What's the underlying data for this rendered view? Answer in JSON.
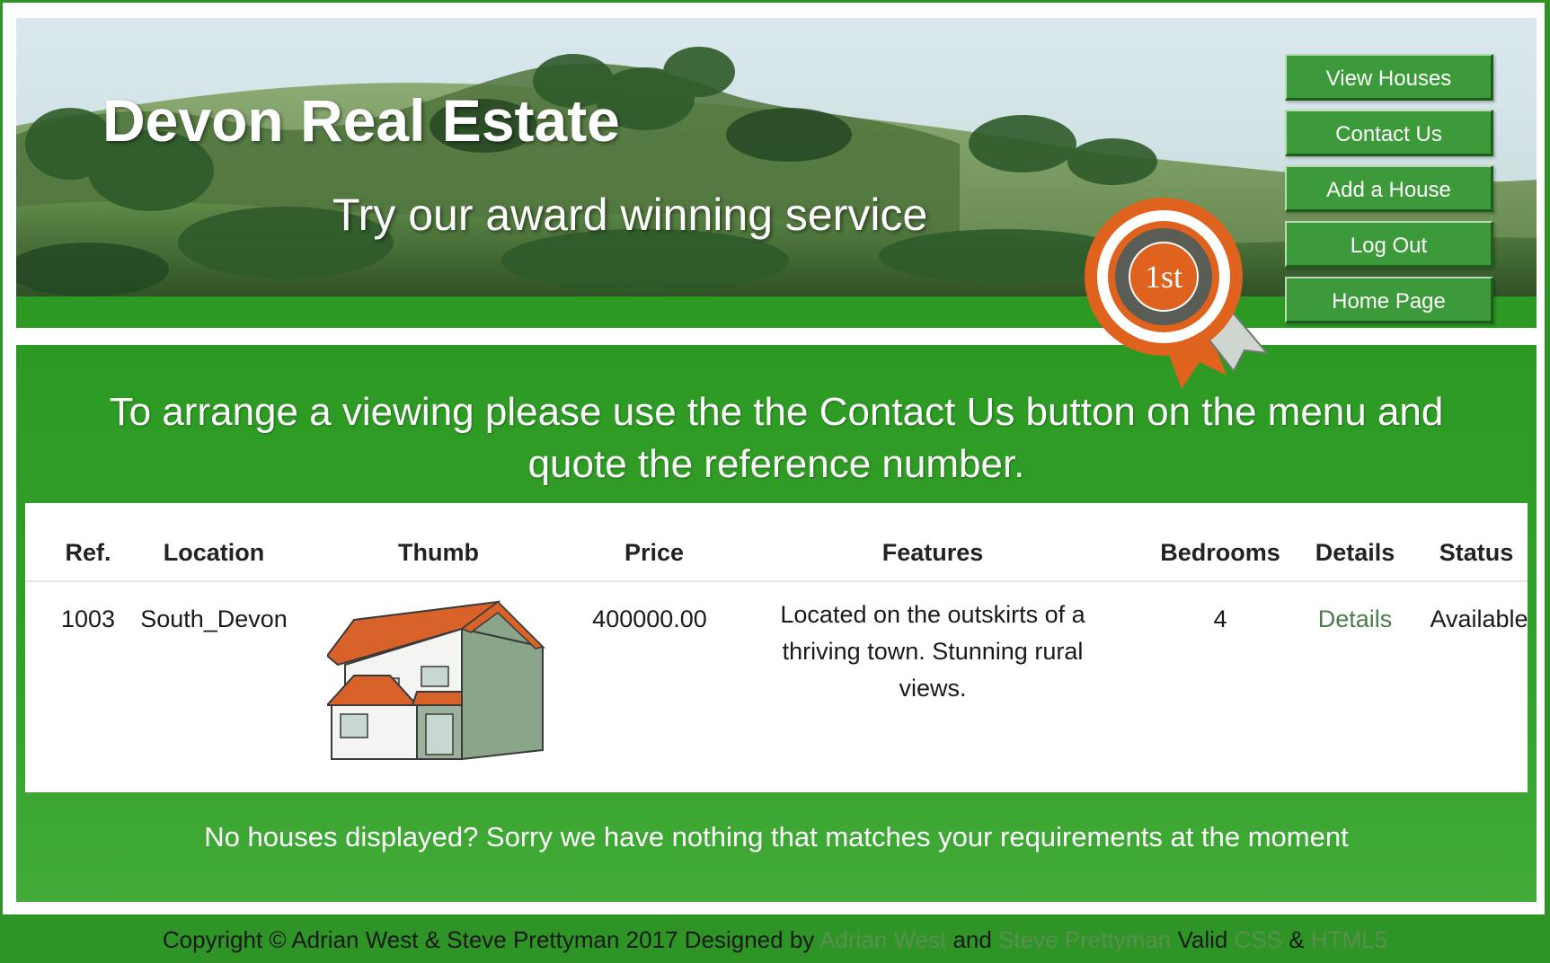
{
  "header": {
    "title": "Devon Real Estate",
    "tagline": "Try our award winning service",
    "badge_text": "1st"
  },
  "nav": {
    "items": [
      {
        "label": "View Houses"
      },
      {
        "label": "Contact Us"
      },
      {
        "label": "Add a House"
      },
      {
        "label": "Log Out"
      },
      {
        "label": "Home Page"
      }
    ]
  },
  "main": {
    "intro_line1": "To arrange a viewing please use the the Contact Us button on the menu and",
    "intro_line2": "quote the reference number.",
    "no_houses": "No houses displayed? Sorry we have nothing that matches your requirements at the moment"
  },
  "table": {
    "headers": [
      "Ref.",
      "Location",
      "Thumb",
      "Price",
      "Features",
      "Bedrooms",
      "Details",
      "Status"
    ],
    "rows": [
      {
        "ref": "1003",
        "location": "South_Devon",
        "price": "400000.00",
        "features_line1": "Located on the outskirts of a",
        "features_line2": "thriving town. Stunning rural",
        "features_line3": "views.",
        "bedrooms": "4",
        "details": "Details",
        "status": "Available"
      }
    ]
  },
  "footer": {
    "text_prefix": "Copyright © Adrian West & Steve Prettyman 2017 Designed by ",
    "author1": "Adrian West",
    "and": " and ",
    "author2": "Steve Prettyman",
    "valid": " Valid ",
    "css": "CSS",
    "amp": " & ",
    "html5": "HTML5"
  },
  "colors": {
    "brand_green": "#2c9a22",
    "badge_orange": "#e0621f",
    "roof_orange": "#d9622b"
  }
}
